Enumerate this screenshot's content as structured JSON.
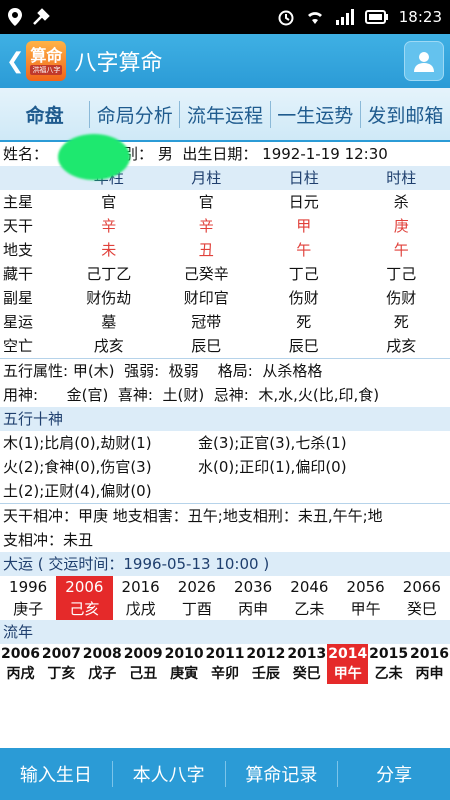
{
  "statusbar": {
    "time": "18:23"
  },
  "appbar": {
    "back": "❮",
    "logo_top": "算命",
    "logo_bottom": "洪福八字",
    "title": "八字算命"
  },
  "tabs": [
    "命盘",
    "命局分析",
    "流年运程",
    "一生运势",
    "发到邮箱"
  ],
  "profile": {
    "name_label": "姓名：",
    "gender_label": "性别：",
    "gender": "男",
    "birth_label": "出生日期：",
    "birth": "1992-1-19 12:30"
  },
  "columns": [
    "",
    "年柱",
    "月柱",
    "日柱",
    "时柱"
  ],
  "rows": [
    {
      "label": "主星",
      "cells": [
        "官",
        "官",
        "日元",
        "杀"
      ]
    },
    {
      "label": "天干",
      "cells": [
        "辛",
        "辛",
        "甲",
        "庚"
      ],
      "red": true
    },
    {
      "label": "地支",
      "cells": [
        "未",
        "丑",
        "午",
        "午"
      ],
      "red": true
    },
    {
      "label": "藏干",
      "cells": [
        "己丁乙",
        "己癸辛",
        "丁己",
        "丁己"
      ]
    },
    {
      "label": "副星",
      "cells": [
        "财伤劫",
        "财印官",
        "伤财",
        "伤财"
      ]
    },
    {
      "label": "星运",
      "cells": [
        "墓",
        "冠带",
        "死",
        "死"
      ]
    },
    {
      "label": "空亡",
      "cells": [
        "戌亥",
        "辰巳",
        "辰巳",
        "戌亥"
      ]
    }
  ],
  "wuxing": {
    "line1": "五行属性: 甲(木)  强弱:  极弱    格局:  从杀格格",
    "line2": "用神:      金(官)  喜神:  土(财)  忌神:  木,水,火(比,印,食)"
  },
  "shishen": {
    "header": "五行十神",
    "lines": [
      [
        "木(1);比肩(0),劫财(1)",
        "金(3);正官(3),七杀(1)"
      ],
      [
        "火(2);食神(0),伤官(3)",
        "水(0);正印(1),偏印(0)"
      ],
      [
        "土(2);正财(4),偏财(0)",
        ""
      ]
    ]
  },
  "relations": {
    "line1": "天干相冲：甲庚  地支相害：丑午;地支相刑：未丑,午午;地",
    "line2": "支相冲：未丑"
  },
  "dayun": {
    "header": "大运 ( 交运时间：1996-05-13 10:00 )",
    "years": [
      "1996",
      "2006",
      "2016",
      "2026",
      "2036",
      "2046",
      "2056",
      "2066"
    ],
    "ganzhi": [
      "庚子",
      "己亥",
      "戊戌",
      "丁酉",
      "丙申",
      "乙未",
      "甲午",
      "癸巳"
    ],
    "highlight_index": 1
  },
  "liunian": {
    "header": "流年",
    "years": [
      "2006",
      "2007",
      "2008",
      "2009",
      "2010",
      "2011",
      "2012",
      "2013",
      "2014",
      "2015",
      "2016"
    ],
    "ganzhi": [
      "丙戌",
      "丁亥",
      "戊子",
      "己丑",
      "庚寅",
      "辛卯",
      "壬辰",
      "癸巳",
      "甲午",
      "乙未",
      "丙申"
    ],
    "highlight_index": 8
  },
  "bottom": [
    "输入生日",
    "本人八字",
    "算命记录",
    "分享"
  ]
}
